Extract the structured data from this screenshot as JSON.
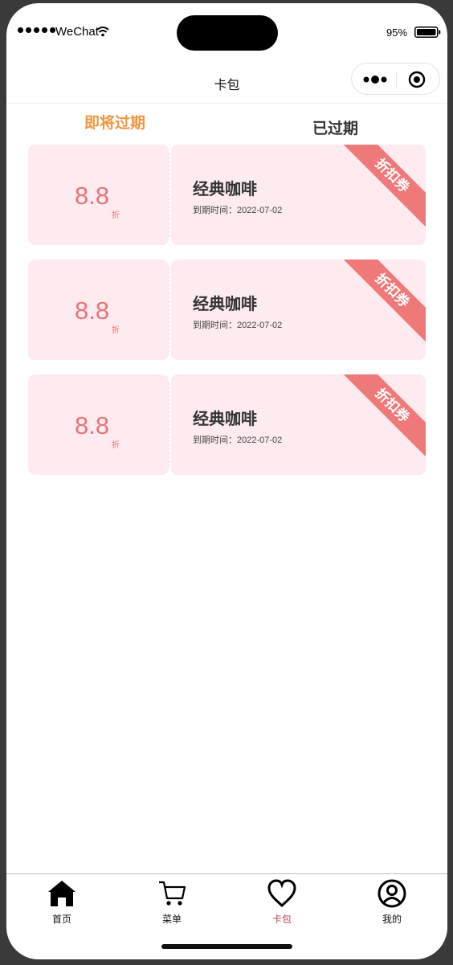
{
  "status_bar": {
    "carrier": "WeChat",
    "battery": "95%",
    "signal_icon": "signal-dots-icon",
    "wifi_icon": "wifi-icon",
    "battery_icon": "battery-icon"
  },
  "nav": {
    "title": "卡包",
    "more_icon": "more-dots-icon",
    "close_icon": "target-circle-icon"
  },
  "tabs": [
    {
      "label": "即将过期",
      "active": true
    },
    {
      "label": "已过期",
      "active": false
    }
  ],
  "colors": {
    "active_tab": "#f2953f",
    "coupon_bg": "#fdebef",
    "discount": "#e87378",
    "ribbon": "#ef7878",
    "tabbar_active": "#c0434f"
  },
  "coupons": [
    {
      "discount": "8.8",
      "unit": "折",
      "name": "经典咖啡",
      "expiry": "到期时间：2022-07-02",
      "tag": "折扣券"
    },
    {
      "discount": "8.8",
      "unit": "折",
      "name": "经典咖啡",
      "expiry": "到期时间：2022-07-02",
      "tag": "折扣券"
    },
    {
      "discount": "8.8",
      "unit": "折",
      "name": "经典咖啡",
      "expiry": "到期时间：2022-07-02",
      "tag": "折扣券"
    }
  ],
  "tabbar": [
    {
      "label": "首页",
      "icon": "home-icon",
      "active": false
    },
    {
      "label": "菜单",
      "icon": "cart-icon",
      "active": false
    },
    {
      "label": "卡包",
      "icon": "heart-icon",
      "active": true
    },
    {
      "label": "我的",
      "icon": "user-circle-icon",
      "active": false
    }
  ]
}
